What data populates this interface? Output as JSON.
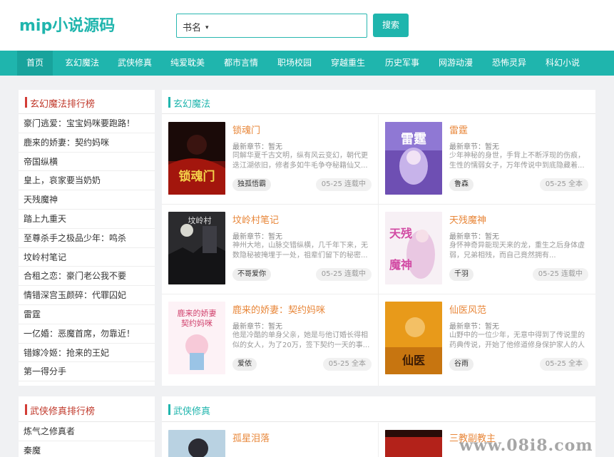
{
  "header": {
    "logo": "mip小说源码",
    "search_select": "书名",
    "search_placeholder": "",
    "search_button": "搜索"
  },
  "nav": [
    "首页",
    "玄幻魔法",
    "武侠修真",
    "纯爱耽美",
    "都市言情",
    "职场校园",
    "穿越重生",
    "历史军事",
    "网游动漫",
    "恐怖灵异",
    "科幻小说"
  ],
  "rank1": {
    "title": "玄幻魔法排行榜",
    "items": [
      "豪门逃爱：宝宝妈咪要跑路！",
      "鹿来的娇妻：契约妈咪",
      "帝国纵横",
      "皇上，哀家要当奶奶",
      "天残魔神",
      "踏上九重天",
      "至尊杀手之极品少年：鸣杀",
      "坟岭村笔记",
      "合租之恋：豪门老公我不要",
      "情错深宫玉颜碎：代罪囚妃",
      "雷霆",
      "一亿婚：恶魔首席，勿靠近！",
      "错嫁冷姬：抢来的王妃",
      "第一得分手"
    ]
  },
  "category1": {
    "title": "玄幻魔法",
    "books": [
      {
        "title": "锁魂门",
        "latest": "最新章节：暂无",
        "desc": "同解华夏千古文明，纵有风云变幻，朝代更迭江湖依旧，修者多如牛毛争夺秘籍仙又...",
        "author": "独孤悟霸",
        "status": "05-25 连载中"
      },
      {
        "title": "雷霆",
        "latest": "最新章节：暂无",
        "desc": "少年神秘的身世，手背上不断浮现的伤痕，生性的懦弱女子，万年传说中到底隐藏着...",
        "author": "鲁森",
        "status": "05-25 全本"
      },
      {
        "title": "坟岭村笔记",
        "latest": "最新章节：暂无",
        "desc": "神州大地，山脉交错纵横，几千年下来，无数隐秘被掩埋于一处，祖辈们留下的秘密...",
        "author": "不哥爱你",
        "status": "05-25 连载中"
      },
      {
        "title": "天残魔神",
        "latest": "最新章节：暂无",
        "desc": "身怀神奇异能现天来的龙，重生之后身体虚弱，兄弟相残，而自己竟然拥有...",
        "author": "千羽",
        "status": "05-25 连载中"
      },
      {
        "title": "鹿来的娇妻：契约妈咪",
        "latest": "最新章节：暂无",
        "desc": "他是冷酷的单身父亲，她是与他订婚长得相似的女人，为了20万，签下契约一天的事...",
        "author": "爱侬",
        "status": "05-25 全本"
      },
      {
        "title": "仙医风范",
        "latest": "最新章节：暂无",
        "desc": "山野中的一位少年，无意中得到了传说里的药典传说，开始了他修道修身保护家人的人生...",
        "author": "谷雨",
        "status": "05-25 全本"
      }
    ]
  },
  "rank2": {
    "title": "武侠修真排行榜",
    "items": [
      "炼气之修真者",
      "秦魔"
    ]
  },
  "category2": {
    "title": "武侠修真",
    "books": [
      {
        "title": "孤星泪落"
      },
      {
        "title": "三教副教主"
      }
    ]
  },
  "colors": {
    "accent": "#1fb5ad",
    "rank_red": "#c0392b",
    "book_title_orange": "#e8873a"
  },
  "icons": {
    "select_caret": "▾"
  },
  "watermark": "www.08i8.com"
}
